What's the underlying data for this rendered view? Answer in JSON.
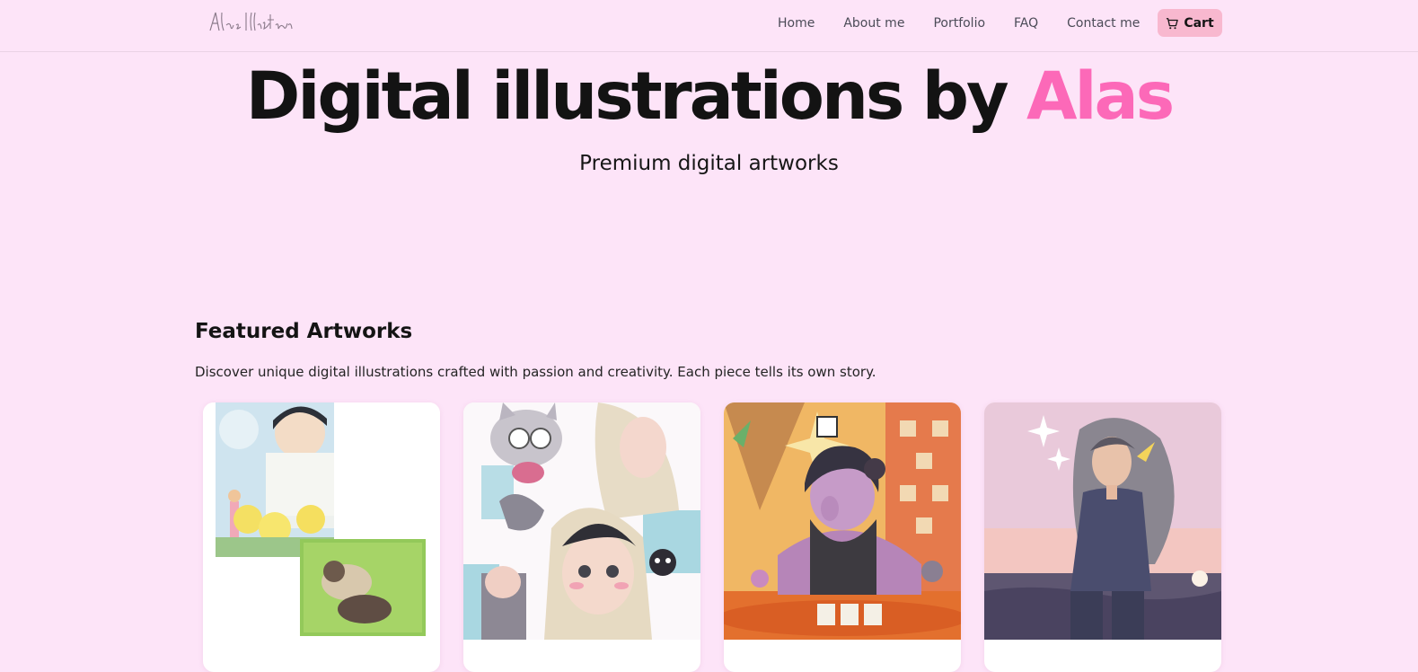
{
  "header": {
    "logo_text": "Alas Illustration",
    "nav": [
      {
        "label": "Home"
      },
      {
        "label": "About me"
      },
      {
        "label": "Portfolio"
      },
      {
        "label": "FAQ"
      },
      {
        "label": "Contact me"
      }
    ],
    "cart_label": "Cart",
    "cart_icon": "cart-icon"
  },
  "hero": {
    "title_main": "Digital illustrations by ",
    "title_accent": "Alas",
    "subtitle": "Premium digital artworks"
  },
  "featured": {
    "heading": "Featured Artworks",
    "description": "Discover unique digital illustrations crafted with passion and creativity. Each piece tells its own story.",
    "artworks": [
      {
        "name": "artwork-boy-garden"
      },
      {
        "name": "artwork-cat-girls-sketch"
      },
      {
        "name": "artwork-boy-playful-backdrop"
      },
      {
        "name": "artwork-girl-sea-sunset"
      }
    ]
  },
  "colors": {
    "background": "#fde4f8",
    "accent": "#fc69b8",
    "cart_button": "#f8b8cf"
  }
}
